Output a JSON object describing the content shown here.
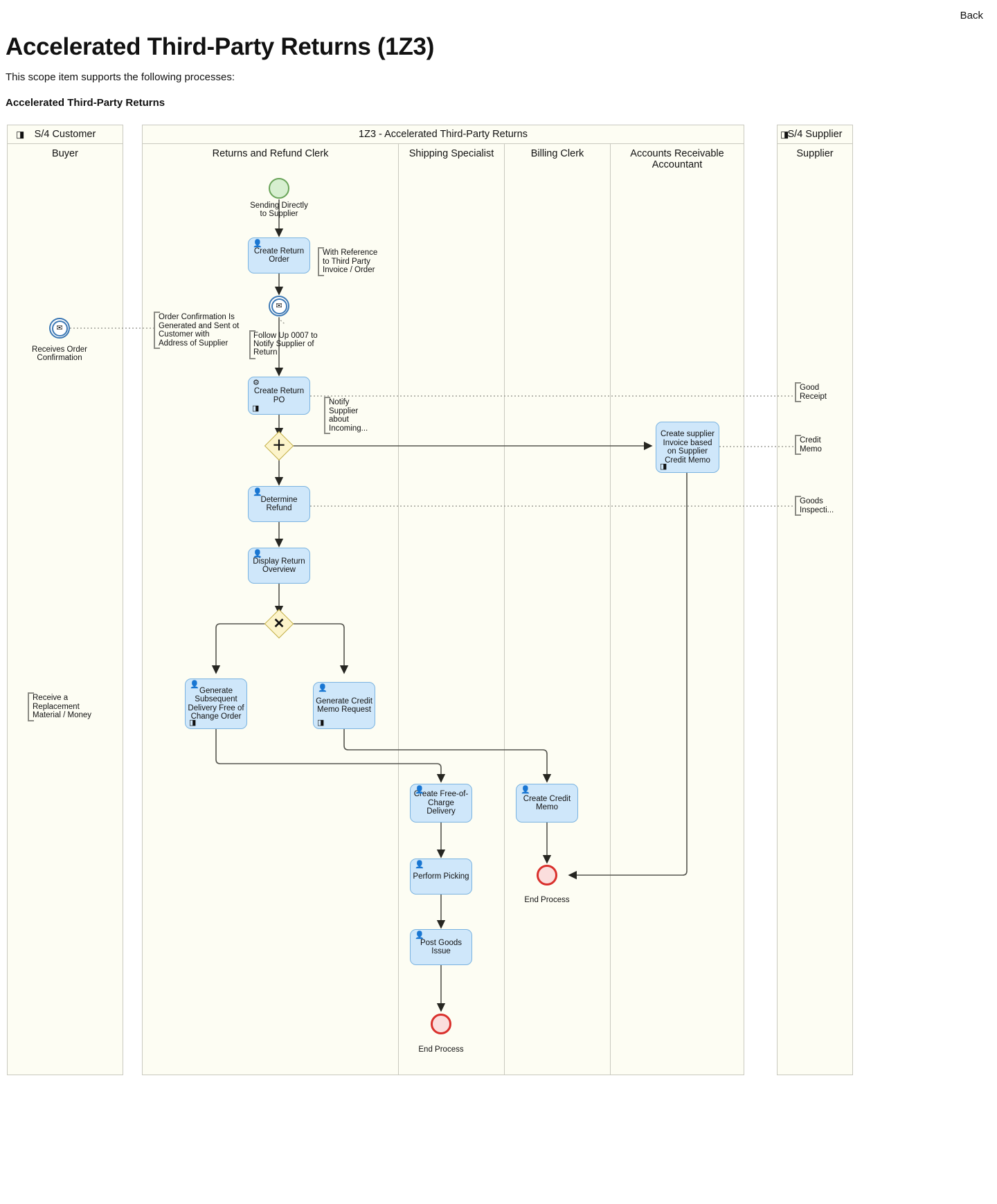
{
  "header": {
    "back_label": "Back",
    "title": "Accelerated Third-Party Returns (1Z3)",
    "subtitle": "This scope item supports the following processes:",
    "process_name": "Accelerated Third-Party Returns"
  },
  "pools": {
    "customer": {
      "title": "S/4 Customer",
      "icon": "system-icon",
      "lanes": [
        {
          "label": "Buyer"
        }
      ]
    },
    "main": {
      "title": "1Z3 - Accelerated Third-Party Returns",
      "lanes": [
        {
          "label": "Returns and Refund Clerk"
        },
        {
          "label": "Shipping Specialist"
        },
        {
          "label": "Billing Clerk"
        },
        {
          "label": "Accounts Receivable Accountant"
        }
      ]
    },
    "supplier": {
      "title": "S/4 Supplier",
      "icon": "system-icon",
      "lanes": [
        {
          "label": "Supplier"
        }
      ]
    }
  },
  "nodes": {
    "start_event_label": "Sending Directly to Supplier",
    "create_return_order": "Create Return Order",
    "msg_event_mid_label": "Follow Up 0007 to Notify Supplier of Return",
    "create_return_po": "Create Return PO",
    "create_supplier_invoice": "Create supplier Invoice based on Supplier Credit Memo",
    "determine_refund": "Determine Refund",
    "display_return_overview": "Display Return Overview",
    "generate_subsequent_delivery": "Generate Subsequent Delivery Free of Change Order",
    "generate_credit_memo_request": "Generate Credit Memo Request",
    "create_foc_delivery": "Create Free-of-Charge Delivery",
    "perform_picking": "Perform Picking",
    "post_goods_issue": "Post Goods Issue",
    "create_credit_memo": "Create Credit Memo",
    "end_process_billing": "End Process",
    "end_process_shipping": "End Process",
    "receives_order_confirmation": "Receives Order Confirmation"
  },
  "annotations": {
    "with_reference": "With Reference to Third Party Invoice / Order",
    "order_confirmation": "Order Confirmation Is Generated and Sent ot Customer with Address of Supplier",
    "notify_supplier_incoming": "Notify Supplier about Incoming...",
    "good_receipt": "Good Receipt",
    "credit_memo": "Credit Memo",
    "goods_inspection": "Goods Inspecti...",
    "receive_replacement": "Receive a Replacement Material / Money"
  },
  "icons": {
    "user_task": "\t",
    "service_task": "⚙",
    "doc_marker": "◨",
    "envelope": "✉",
    "parallel_gateway": "＋",
    "exclusive_gateway": "✕",
    "system_badge": "◨"
  },
  "colors": {
    "task_fill": "#cfe7fa",
    "task_stroke": "#7ab3e0",
    "pool_fill": "#fdfdf3",
    "start_fill": "#d7efd0",
    "start_stroke": "#68a357",
    "end_fill": "#fbdedd",
    "end_stroke": "#d9302c",
    "gateway_fill": "#fcf4cb",
    "gateway_stroke": "#c4b14a",
    "message_stroke": "#3c78b4",
    "flow_stroke": "#4a4a45"
  }
}
